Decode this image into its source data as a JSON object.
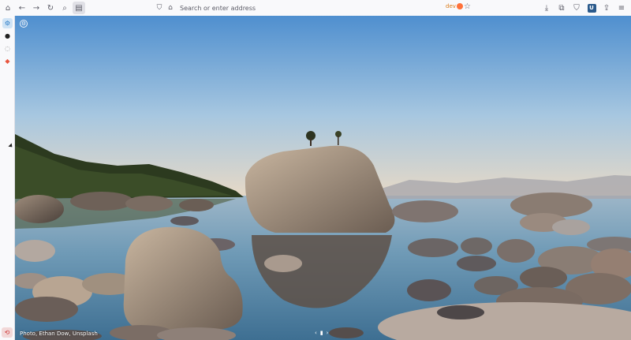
{
  "toolbar": {
    "back_icon": "arrow-left-icon",
    "forward_icon": "arrow-right-icon",
    "reload_icon": "reload-icon",
    "search_icon": "search-icon",
    "sidebar_toggle_icon": "sidebar-icon"
  },
  "urlbar": {
    "placeholder": "Search or enter address",
    "badge": "dev"
  },
  "newtab": {
    "photo_credit": "Photo, Ethan Dow, Unsplash"
  },
  "colors": {
    "accent": "#ff7139",
    "sidebar_selected": "#cfe3f5"
  }
}
